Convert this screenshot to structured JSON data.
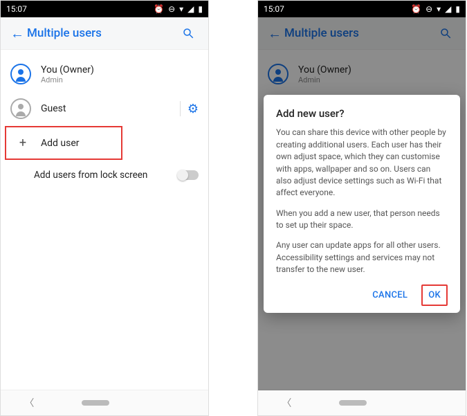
{
  "status": {
    "time": "15:07"
  },
  "appbar": {
    "title": "Multiple users"
  },
  "users": {
    "owner": {
      "name": "You (Owner)",
      "role": "Admin"
    },
    "guest": {
      "name": "Guest"
    }
  },
  "actions": {
    "add_user": "Add user",
    "lock_screen": "Add users from lock screen"
  },
  "dialog": {
    "title": "Add new user?",
    "p1": "You can share this device with other people by creating additional users. Each user has their own adjust space, which they can customise with apps, wallpaper and so on. Users can also adjust device settings such as Wi-Fi that affect everyone.",
    "p2": "When you add a new user, that person needs to set up their space.",
    "p3": "Any user can update apps for all other users. Accessibility settings and services may not transfer to the new user.",
    "cancel": "CANCEL",
    "ok": "OK"
  }
}
